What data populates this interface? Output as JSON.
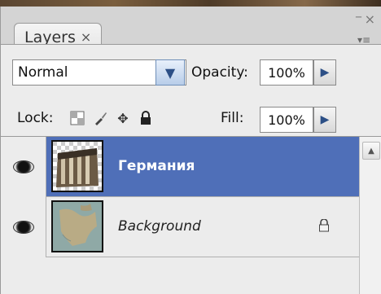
{
  "panel": {
    "tab_label": "Layers",
    "tab_close": "×",
    "minimize": "–",
    "close": "×",
    "menu": "▾≡"
  },
  "controls": {
    "blend_mode": "Normal",
    "opacity_label": "Opacity:",
    "opacity_value": "100%",
    "lock_label": "Lock:",
    "fill_label": "Fill:",
    "fill_value": "100%"
  },
  "layers": [
    {
      "name": "Германия",
      "selected": true,
      "visible": true
    },
    {
      "name": "Background",
      "selected": false,
      "visible": true,
      "locked": true
    }
  ],
  "colors": {
    "selected_row": "#4f6fb8"
  }
}
